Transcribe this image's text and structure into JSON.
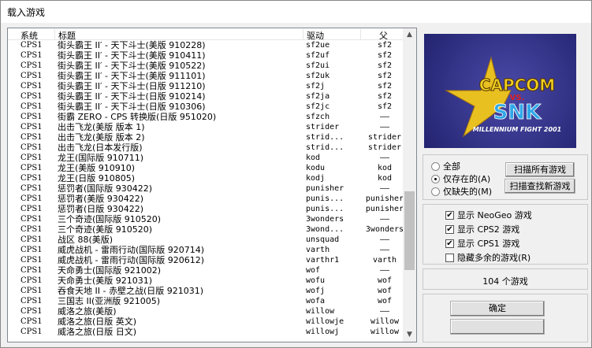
{
  "window": {
    "title": "载入游戏"
  },
  "list": {
    "headers": [
      "系统",
      "标题",
      "驱动",
      "父"
    ],
    "rows": [
      [
        "CPS1",
        "街头霸王 II′ - 天下斗士(美版 910228)",
        "sf2ue",
        "sf2"
      ],
      [
        "CPS1",
        "街头霸王 II′ - 天下斗士(美版 910411)",
        "sf2uf",
        "sf2"
      ],
      [
        "CPS1",
        "街头霸王 II′ - 天下斗士(美版 910522)",
        "sf2ui",
        "sf2"
      ],
      [
        "CPS1",
        "街头霸王 II′ - 天下斗士(美版 911101)",
        "sf2uk",
        "sf2"
      ],
      [
        "CPS1",
        "街头霸王 II′ - 天下斗士(日版 911210)",
        "sf2j",
        "sf2"
      ],
      [
        "CPS1",
        "街头霸王 II′ - 天下斗士(日版 910214)",
        "sf2ja",
        "sf2"
      ],
      [
        "CPS1",
        "街头霸王 II′ - 天下斗士(日版 910306)",
        "sf2jc",
        "sf2"
      ],
      [
        "CPS1",
        "街霸 ZERO - CPS 转换版(日版 951020)",
        "sfzch",
        "——"
      ],
      [
        "CPS1",
        "出击飞龙(美版 版本 1)",
        "strider",
        "——"
      ],
      [
        "CPS1",
        "出击飞龙(美版 版本 2)",
        "strid...",
        "strider"
      ],
      [
        "CPS1",
        "出击飞龙(日本发行版)",
        "strid...",
        "strider"
      ],
      [
        "CPS1",
        "龙王(国际版 910711)",
        "kod",
        "——"
      ],
      [
        "CPS1",
        "龙王(美版 910910)",
        "kodu",
        "kod"
      ],
      [
        "CPS1",
        "龙王(日版 910805)",
        "kodj",
        "kod"
      ],
      [
        "CPS1",
        "惩罚者(国际版 930422)",
        "punisher",
        "——"
      ],
      [
        "CPS1",
        "惩罚者(美版 930422)",
        "punis...",
        "punisher"
      ],
      [
        "CPS1",
        "惩罚者(日版 930422)",
        "punis...",
        "punisher"
      ],
      [
        "CPS1",
        "三个奇迹(国际版 910520)",
        "3wonders",
        "——"
      ],
      [
        "CPS1",
        "三个奇迹(美版 910520)",
        "3wond...",
        "3wonders"
      ],
      [
        "CPS1",
        "战区 88(美版)",
        "unsquad",
        "——"
      ],
      [
        "CPS1",
        "威虎战机 - 雷雨行动(国际版 920714)",
        "varth",
        "——"
      ],
      [
        "CPS1",
        "威虎战机 - 雷雨行动(国际版 920612)",
        "varthr1",
        "varth"
      ],
      [
        "CPS1",
        "天命勇士(国际版 921002)",
        "wof",
        "——"
      ],
      [
        "CPS1",
        "天命勇士(美版 921031)",
        "wofu",
        "wof"
      ],
      [
        "CPS1",
        "吞食天地 II - 赤壁之战(日版 921031)",
        "wofj",
        "wof"
      ],
      [
        "CPS1",
        "三国志 II(亚洲版 921005)",
        "wofa",
        "wof"
      ],
      [
        "CPS1",
        "威洛之旅(美版)",
        "willow",
        "——"
      ],
      [
        "CPS1",
        "威洛之旅(日版 英文)",
        "willowje",
        "willow"
      ],
      [
        "CPS1",
        "威洛之旅(日版 日文)",
        "willowj",
        "willow"
      ]
    ],
    "scroll_position": 0.72
  },
  "preview": {
    "logo_text_1": "CAPCOM",
    "logo_text_2": "VS.",
    "logo_text_3": "SNK",
    "logo_subtitle": "MILLENNIUM FIGHT 2001"
  },
  "filter": {
    "all": "全部",
    "existing": "仅存在的(A)",
    "missing": "仅缺失的(M)",
    "selected": "existing"
  },
  "scan": {
    "scan_all": "扫描所有游戏",
    "scan_new": "扫描查找新游戏"
  },
  "options": [
    {
      "label": "显示 NeoGeo 游戏",
      "checked": true
    },
    {
      "label": "显示 CPS2 游戏",
      "checked": true
    },
    {
      "label": "显示 CPS1 游戏",
      "checked": true
    },
    {
      "label": "隐藏多余的游戏(R)",
      "checked": false
    }
  ],
  "count": "104 个游戏",
  "buttons": {
    "ok": "确定"
  },
  "colors": {
    "accent": "#f0f0f0",
    "logo_bg": "#2c2c80"
  }
}
